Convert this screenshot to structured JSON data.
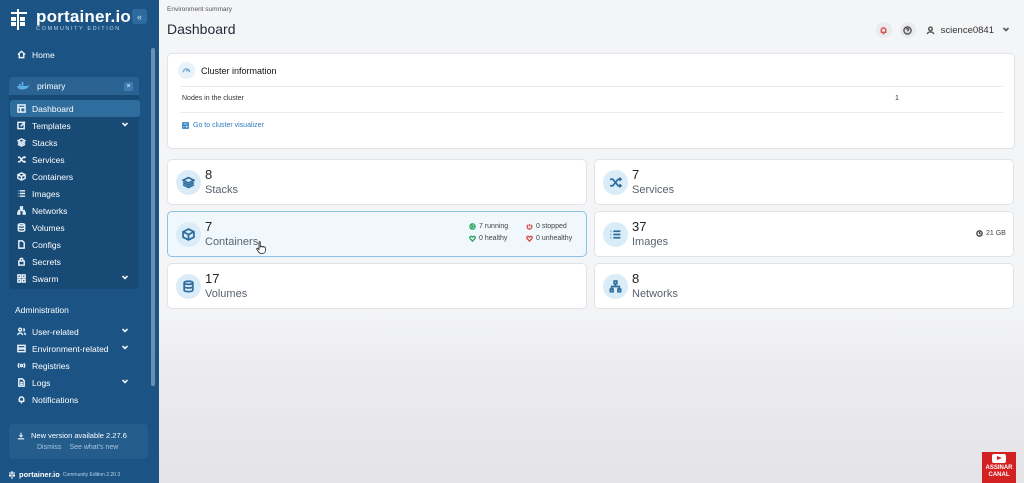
{
  "brand": {
    "name": "portainer.io",
    "edition": "COMMUNITY EDITION",
    "collapse_glyph": "«"
  },
  "sidebar": {
    "home": "Home",
    "environment": {
      "name": "primary",
      "close_glyph": "×"
    },
    "env_items": [
      {
        "label": "Dashboard",
        "icon": "dashboard-icon",
        "active": true
      },
      {
        "label": "Templates",
        "icon": "edit-icon",
        "chevron": true
      },
      {
        "label": "Stacks",
        "icon": "layers-icon"
      },
      {
        "label": "Services",
        "icon": "shuffle-icon"
      },
      {
        "label": "Containers",
        "icon": "box-icon"
      },
      {
        "label": "Images",
        "icon": "list-icon"
      },
      {
        "label": "Networks",
        "icon": "network-icon"
      },
      {
        "label": "Volumes",
        "icon": "database-icon"
      },
      {
        "label": "Configs",
        "icon": "file-icon"
      },
      {
        "label": "Secrets",
        "icon": "lock-icon"
      },
      {
        "label": "Swarm",
        "icon": "grid-icon",
        "chevron": true
      }
    ],
    "admin_title": "Administration",
    "admin_items": [
      {
        "label": "User-related",
        "icon": "users-icon",
        "chevron": true
      },
      {
        "label": "Environment-related",
        "icon": "server-icon",
        "chevron": true
      },
      {
        "label": "Registries",
        "icon": "radio-icon"
      },
      {
        "label": "Logs",
        "icon": "file-text-icon",
        "chevron": true
      },
      {
        "label": "Notifications",
        "icon": "bell-icon"
      }
    ],
    "update": {
      "text": "New version available 2.27.6",
      "dismiss": "Dismiss",
      "whats_new": "See what's new"
    },
    "footer": {
      "name": "portainer.io",
      "version": "Community Edition 2.20.3"
    }
  },
  "header": {
    "breadcrumb": "Environment summary",
    "title": "Dashboard",
    "username": "science0841"
  },
  "cluster": {
    "title": "Cluster information",
    "nodes_label": "Nodes in the cluster",
    "nodes_value": "1",
    "visualizer_link": "Go to cluster visualizer"
  },
  "stats": {
    "stacks": {
      "count": "8",
      "label": "Stacks"
    },
    "services": {
      "count": "7",
      "label": "Services"
    },
    "containers": {
      "count": "7",
      "label": "Containers",
      "running": "7 running",
      "stopped": "0 stopped",
      "healthy": "0 healthy",
      "unhealthy": "0 unhealthy"
    },
    "images": {
      "count": "37",
      "label": "Images",
      "size": "21 GB"
    },
    "volumes": {
      "count": "17",
      "label": "Volumes"
    },
    "networks": {
      "count": "8",
      "label": "Networks"
    }
  },
  "overlay": {
    "line1": "ASSINAR",
    "line2": "CANAL"
  },
  "colors": {
    "sidebar_bg": "#1b5484",
    "accent": "#2f7cc1",
    "running": "#3aa56b",
    "stopped": "#d9534f"
  }
}
